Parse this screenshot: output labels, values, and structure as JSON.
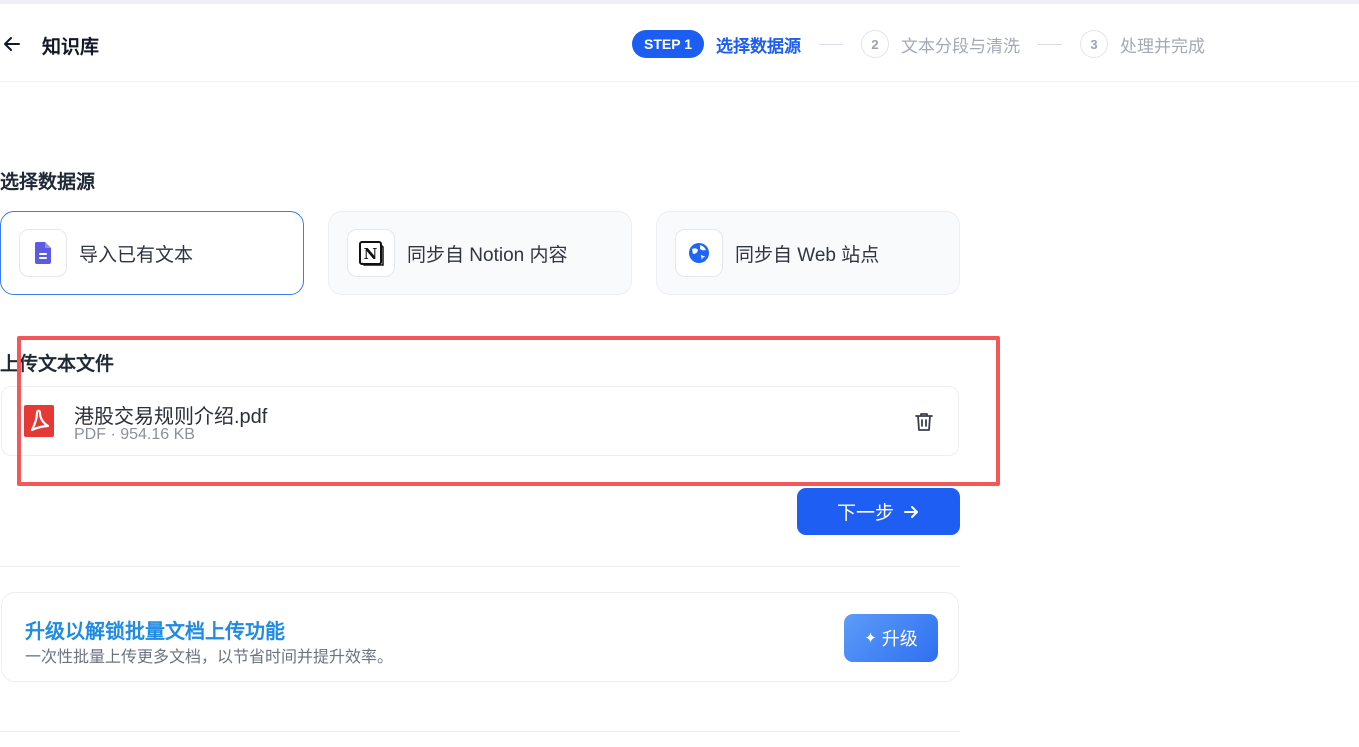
{
  "header": {
    "title": "知识库",
    "steps": [
      {
        "badge": "STEP 1",
        "label": "选择数据源"
      },
      {
        "badge": "2",
        "label": "文本分段与清洗"
      },
      {
        "badge": "3",
        "label": "处理并完成"
      }
    ]
  },
  "datasource": {
    "section_title": "选择数据源",
    "options": [
      {
        "label": "导入已有文本",
        "icon": "document-icon",
        "selected": true
      },
      {
        "label": "同步自 Notion 内容",
        "icon": "notion-icon",
        "selected": false
      },
      {
        "label": "同步自 Web 站点",
        "icon": "web-icon",
        "selected": false
      }
    ]
  },
  "upload": {
    "section_title": "上传文本文件",
    "file": {
      "name": "港股交易规则介绍.pdf",
      "meta": "PDF · 954.16 KB"
    }
  },
  "actions": {
    "next_label": "下一步"
  },
  "upgrade": {
    "title": "升级以解锁批量文档上传功能",
    "description": "一次性批量上传更多文档，以节省时间并提升效率。",
    "button_label": "升级"
  },
  "colors": {
    "accent": "#1d5ef2",
    "highlight": "#f25858",
    "pdf_red": "#e53935",
    "upgrade_title": "#1f8be3"
  }
}
